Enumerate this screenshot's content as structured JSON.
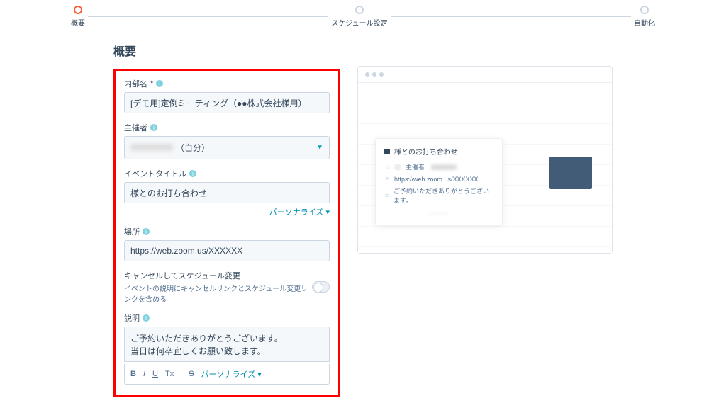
{
  "stepper": {
    "step1": "概要",
    "step2": "スケジュール設定",
    "step3": "自動化"
  },
  "section_title": "概要",
  "fields": {
    "internal_name": {
      "label": "内部名",
      "value": "[デモ用]定例ミーティング（●●株式会社様用）"
    },
    "organizer": {
      "label": "主催者",
      "suffix": "（自分）"
    },
    "event_title": {
      "label": "イベントタイトル",
      "value": "様とのお打ち合わせ",
      "personalize": "パーソナライズ"
    },
    "location": {
      "label": "場所",
      "value": "https://web.zoom.us/XXXXXX"
    },
    "cancel": {
      "label": "キャンセルしてスケジュール変更",
      "desc": "イベントの説明にキャンセルリンクとスケジュール変更リンクを含める"
    },
    "description": {
      "label": "説明",
      "value": "ご予約いただきありがとうございます。\n当日は何卒宜しくお願い致します。",
      "personalize": "パーソナライズ"
    }
  },
  "toolbar": {
    "bold": "B",
    "italic": "I",
    "underline": "U",
    "clear": "Tx",
    "strike": "S"
  },
  "preview": {
    "event_title": "様とのお打ち合わせ",
    "organizer_label": "主催者:",
    "location": "https://web.zoom.us/XXXXXX",
    "desc": "ご予約いただきありがとうございます。"
  }
}
